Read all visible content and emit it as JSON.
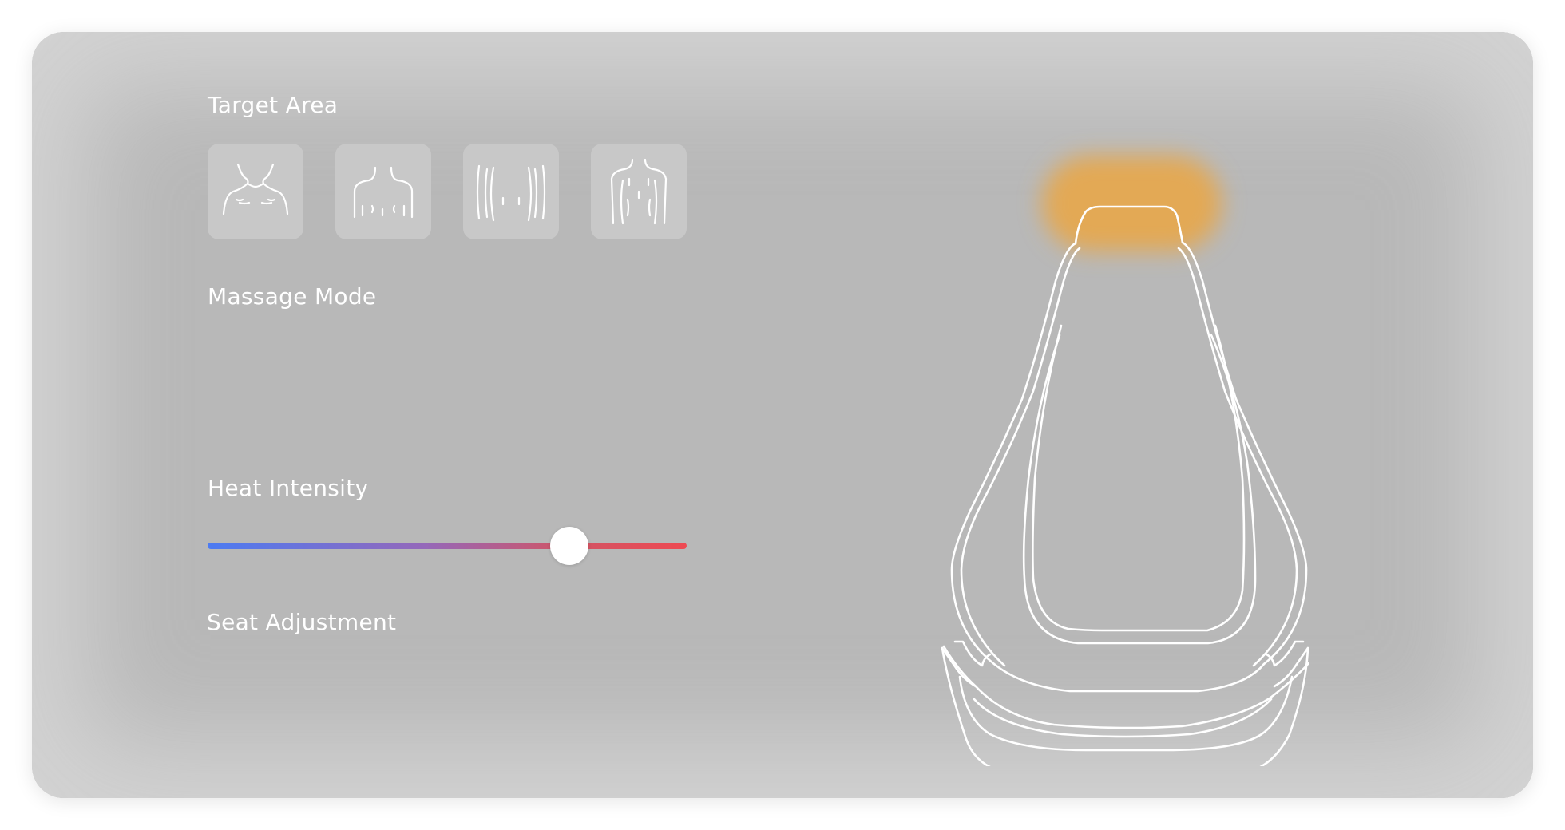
{
  "target_area": {
    "title": "Target Area",
    "options": [
      {
        "icon": "neck-shoulders-icon"
      },
      {
        "icon": "upper-back-icon"
      },
      {
        "icon": "lower-back-icon"
      },
      {
        "icon": "full-back-icon"
      }
    ],
    "highlighted_zone": "neck"
  },
  "massage_mode": {
    "title": "Massage Mode"
  },
  "heat_intensity": {
    "title": "Heat Intensity",
    "value_fraction": 0.755,
    "gradient_start": "#4c7bf2",
    "gradient_end": "#ee4a52"
  },
  "seat_adjustment": {
    "title": "Seat Adjustment"
  },
  "seat_visual": {
    "icon": "massage-seat-icon",
    "highlight_color": "#e3a955"
  }
}
